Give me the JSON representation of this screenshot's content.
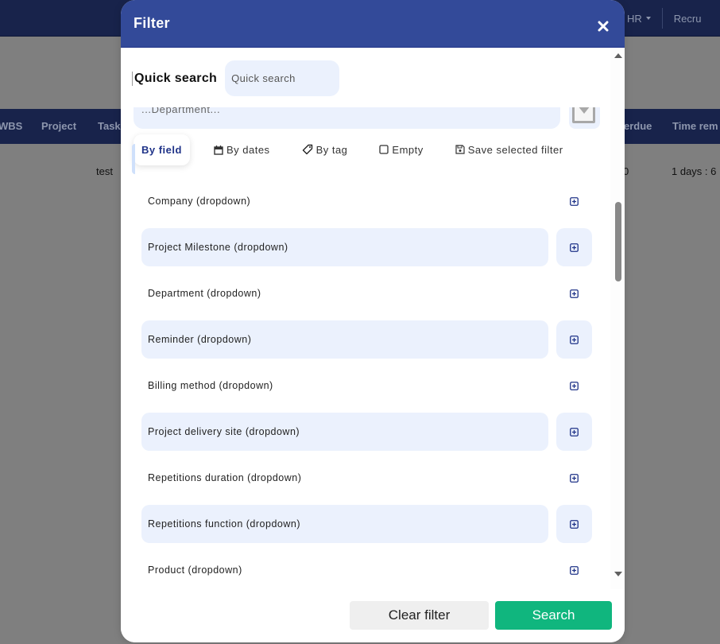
{
  "background": {
    "top_nav": [
      {
        "label": "HR",
        "has_caret": true
      },
      {
        "label": "Recru",
        "has_caret": false
      }
    ],
    "table_headers_left": [
      "WBS",
      "Project",
      "Task"
    ],
    "table_headers_right": [
      "erdue",
      "Time rem"
    ],
    "row_cells": {
      "left": "test",
      "right_a": "0",
      "right_b": "1 days : 6"
    }
  },
  "modal": {
    "title": "Filter",
    "close_icon": "close-icon",
    "quick_search": {
      "label": "Quick search",
      "placeholder": "Quick search",
      "value": ""
    },
    "department_select": {
      "text": "...Department..."
    },
    "tabs": [
      {
        "label": "By field",
        "icon": null,
        "active": true
      },
      {
        "label": "By dates",
        "icon": "calendar-icon",
        "active": false
      },
      {
        "label": "By tag",
        "icon": "tag-icon",
        "active": false
      },
      {
        "label": "Empty",
        "icon": "checkbox-icon",
        "active": false
      },
      {
        "label": "Save selected filter",
        "icon": "save-icon",
        "active": false
      }
    ],
    "fields": [
      {
        "label": "Company (dropdown)",
        "shaded": false
      },
      {
        "label": "Project Milestone (dropdown)",
        "shaded": true
      },
      {
        "label": "Department (dropdown)",
        "shaded": false
      },
      {
        "label": "Reminder (dropdown)",
        "shaded": true
      },
      {
        "label": "Billing method (dropdown)",
        "shaded": false
      },
      {
        "label": "Project delivery site (dropdown)",
        "shaded": true
      },
      {
        "label": "Repetitions duration (dropdown)",
        "shaded": false
      },
      {
        "label": "Repetitions function (dropdown)",
        "shaded": true
      },
      {
        "label": "Product (dropdown)",
        "shaded": false
      }
    ],
    "footer": {
      "clear_label": "Clear filter",
      "search_label": "Search"
    },
    "colors": {
      "header": "#334a99",
      "accent_text": "#1f3388",
      "field_bg": "#ebf1fd",
      "search_button": "#10b67e",
      "clear_button": "#efefef"
    }
  }
}
